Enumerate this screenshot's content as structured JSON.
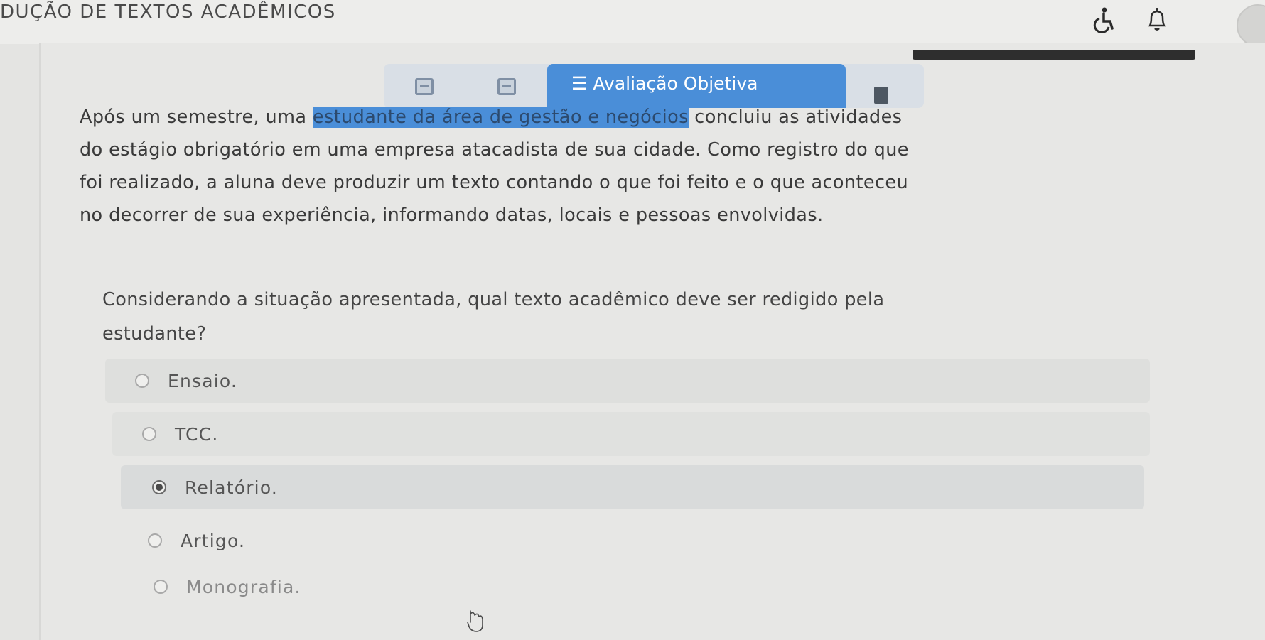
{
  "header": {
    "course_title": "DUÇÃO DE TEXTOS ACADÊMICOS",
    "icons": [
      "accessibility-icon",
      "bell-icon",
      "avatar"
    ]
  },
  "toolbar": {
    "active_tab_label": "Avaliação Objetiva",
    "active_tab_icon": "list-icon",
    "accent_color": "#4a8ed8"
  },
  "statement": {
    "lines": [
      {
        "pre": "Após um semestre, uma ",
        "highlight": "estudante da área de gestão e negócios",
        "post": " concluiu as atividades"
      },
      {
        "text": "do estágio obrigatório em uma empresa atacadista de sua cidade. Como registro do que"
      },
      {
        "text": "foi realizado, a aluna deve produzir um texto contando o que foi feito e o que aconteceu"
      },
      {
        "text": "no decorrer de sua experiência, informando datas, locais e pessoas envolvidas."
      }
    ]
  },
  "question": {
    "line1": "Considerando a situação apresentada, qual texto acadêmico deve ser redigido pela",
    "line2": "estudante?"
  },
  "options": [
    {
      "label": "Ensaio.",
      "selected": false
    },
    {
      "label": "TCC.",
      "selected": false
    },
    {
      "label": "Relatório.",
      "selected": true
    },
    {
      "label": "Artigo.",
      "selected": false
    },
    {
      "label": "Monografia.",
      "selected": false
    }
  ]
}
